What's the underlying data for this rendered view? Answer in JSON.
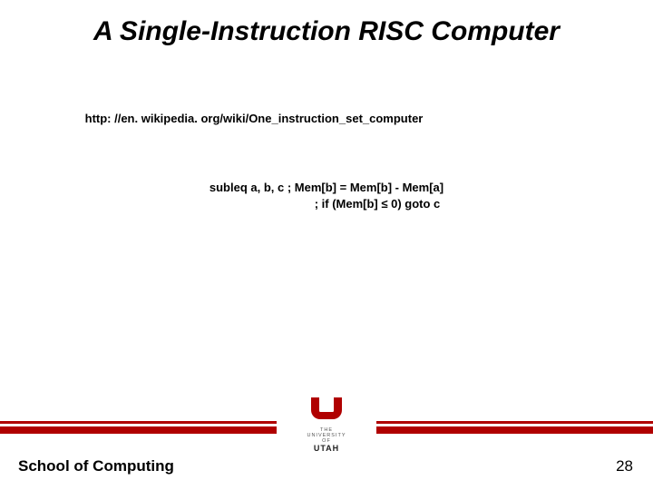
{
  "title": "A Single-Instruction RISC Computer",
  "url": "http: //en. wikipedia. org/wiki/One_instruction_set_computer",
  "code": {
    "line1": "subleq a, b, c   ; Mem[b] = Mem[b] - Mem[a]",
    "line2": "; if (Mem[b] ≤ 0) goto c"
  },
  "logo": {
    "small_top": "THE",
    "small_mid": "UNIVERSITY",
    "small_of": "OF",
    "main": "UTAH"
  },
  "footer": {
    "left": "School of Computing",
    "page": "28"
  }
}
